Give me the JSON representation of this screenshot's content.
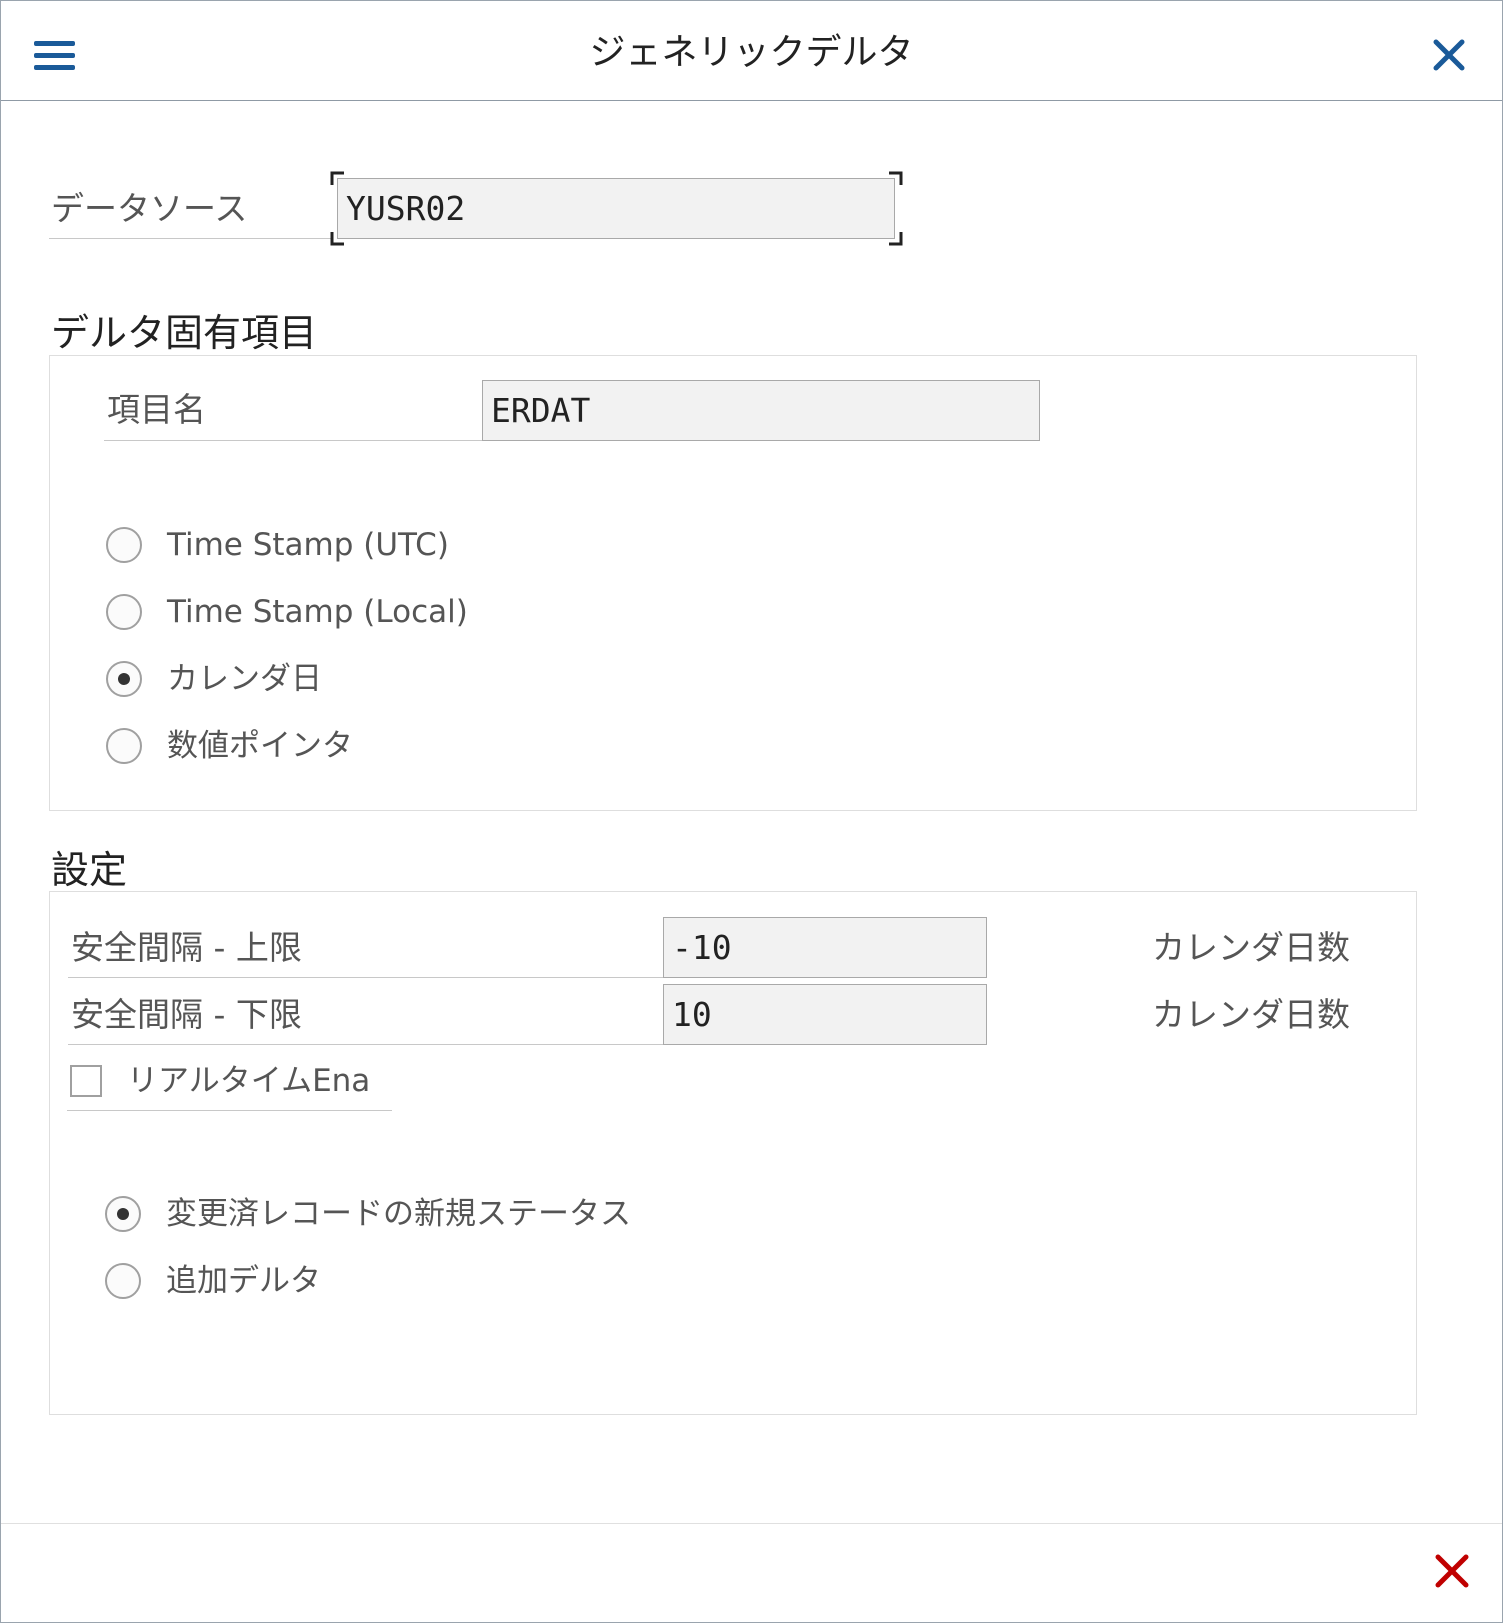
{
  "dialog": {
    "title": "ジェネリックデルタ",
    "menu_icon": "hamburger-icon",
    "close_icon": "close-x-icon",
    "cancel_icon": "cancel-x-icon",
    "accent_color": "#1a5a99",
    "cancel_color": "#c00000"
  },
  "datasource": {
    "label": "データソース",
    "value": "YUSR02"
  },
  "delta_field_section": {
    "title": "デルタ固有項目",
    "field_name_label": "項目名",
    "field_name_value": "ERDAT",
    "delta_types": [
      {
        "label": "Time Stamp (UTC)",
        "selected": false
      },
      {
        "label": "Time Stamp (Local)",
        "selected": false
      },
      {
        "label": "カレンダ日",
        "selected": true
      },
      {
        "label": "数値ポインタ",
        "selected": false
      }
    ]
  },
  "settings_section": {
    "title": "設定",
    "upper_limit_label": "安全間隔 - 上限",
    "upper_limit_value": "-10",
    "upper_limit_unit": "カレンダ日数",
    "lower_limit_label": "安全間隔 - 下限",
    "lower_limit_value": "10",
    "lower_limit_unit": "カレンダ日数",
    "realtime_label": "リアルタイムEna",
    "realtime_checked": false,
    "record_modes": [
      {
        "label": "変更済レコードの新規ステータス",
        "selected": true
      },
      {
        "label": "追加デルタ",
        "selected": false
      }
    ]
  }
}
